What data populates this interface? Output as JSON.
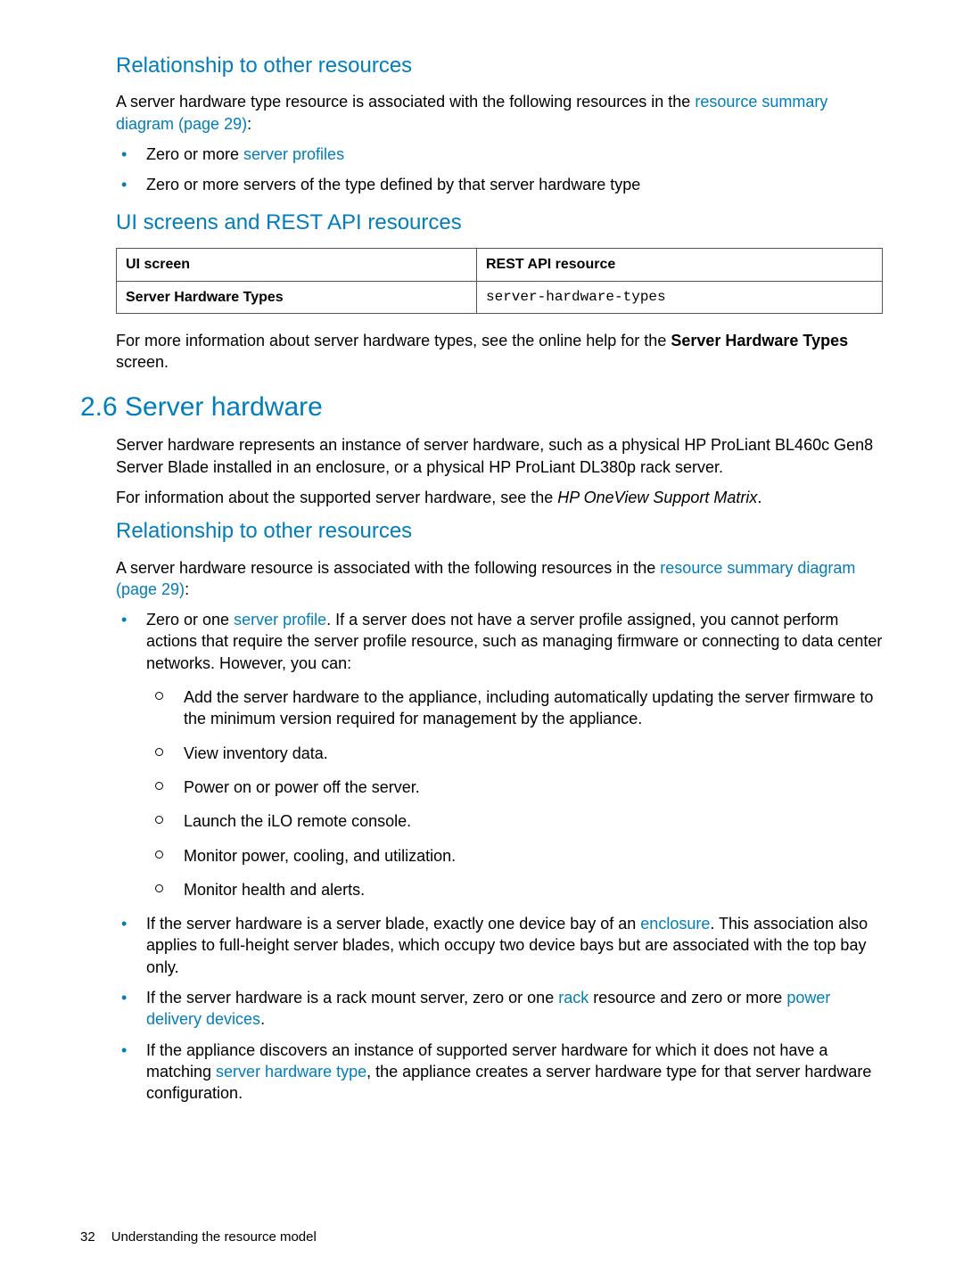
{
  "section_a": {
    "heading": "Relationship to other resources",
    "para_pre": "A server hardware type resource is associated with the following resources in the ",
    "link": "resource summary diagram (page 29)",
    "para_post": ":",
    "bullets": {
      "b1_pre": "Zero or more ",
      "b1_link": "server profiles",
      "b2": "Zero or more servers of the type defined by that server hardware type"
    }
  },
  "section_b": {
    "heading": "UI screens and REST API resources",
    "table": {
      "h1": "UI screen",
      "h2": "REST API resource",
      "r1c1": "Server Hardware Types",
      "r1c2": "server-hardware-types"
    },
    "after_para_pre": "For more information about server hardware types, see the online help for the ",
    "after_bold": "Server Hardware Types",
    "after_para_post": " screen."
  },
  "section_c": {
    "heading": "2.6 Server hardware",
    "p1": "Server hardware represents an instance of server hardware, such as a physical HP ProLiant BL460c Gen8 Server Blade installed in an enclosure, or a physical HP ProLiant DL380p rack server.",
    "p2_pre": "For information about the supported server hardware, see the ",
    "p2_italic": "HP OneView Support Matrix",
    "p2_post": "."
  },
  "section_d": {
    "heading": "Relationship to other resources",
    "para_pre": "A server hardware resource is associated with the following resources in the ",
    "link": "resource summary diagram (page 29)",
    "para_post": ":",
    "b1_pre": "Zero or one ",
    "b1_link": "server profile",
    "b1_post": ". If a server does not have a server profile assigned, you cannot perform actions that require the server profile resource, such as managing firmware or connecting to data center networks. However, you can:",
    "sub": {
      "s1": "Add the server hardware to the appliance, including automatically updating the server firmware to the minimum version required for management by the appliance.",
      "s2": "View inventory data.",
      "s3": "Power on or power off the server.",
      "s4": "Launch the iLO remote console.",
      "s5": "Monitor power, cooling, and utilization.",
      "s6": "Monitor health and alerts."
    },
    "b2_pre": "If the server hardware is a server blade, exactly one device bay of an ",
    "b2_link": "enclosure",
    "b2_post": ". This association also applies to full-height server blades, which occupy two device bays but are associated with the top bay only.",
    "b3_pre": "If the server hardware is a rack mount server, zero or one ",
    "b3_link1": "rack",
    "b3_mid": " resource and zero or more ",
    "b3_link2": "power delivery devices",
    "b3_post": ".",
    "b4_pre": "If the appliance discovers an instance of supported server hardware for which it does not have a matching ",
    "b4_link": "server hardware type",
    "b4_post": ", the appliance creates a server hardware type for that server hardware configuration."
  },
  "footer": {
    "page_num": "32",
    "title": "Understanding the resource model"
  }
}
